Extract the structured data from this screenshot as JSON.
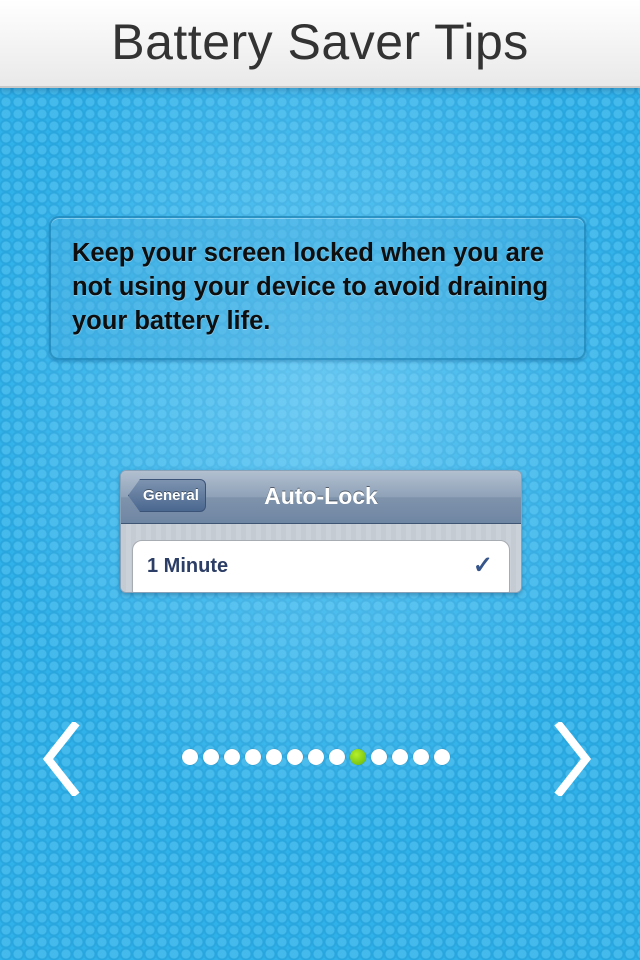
{
  "header": {
    "title": "Battery Saver Tips"
  },
  "tip": {
    "text": "Keep your screen locked when you are not using your device to avoid draining your battery life."
  },
  "illustration": {
    "back_button": "General",
    "nav_title": "Auto-Lock",
    "selected_option": "1 Minute",
    "checkmark": "✓"
  },
  "pager": {
    "total_pages": 13,
    "current_page": 9
  },
  "icons": {
    "previous": "chevron-left-icon",
    "next": "chevron-right-icon"
  },
  "colors": {
    "background": "#2fb2ea",
    "active_dot": "#7fd41a",
    "header": "#f2f2f2"
  }
}
